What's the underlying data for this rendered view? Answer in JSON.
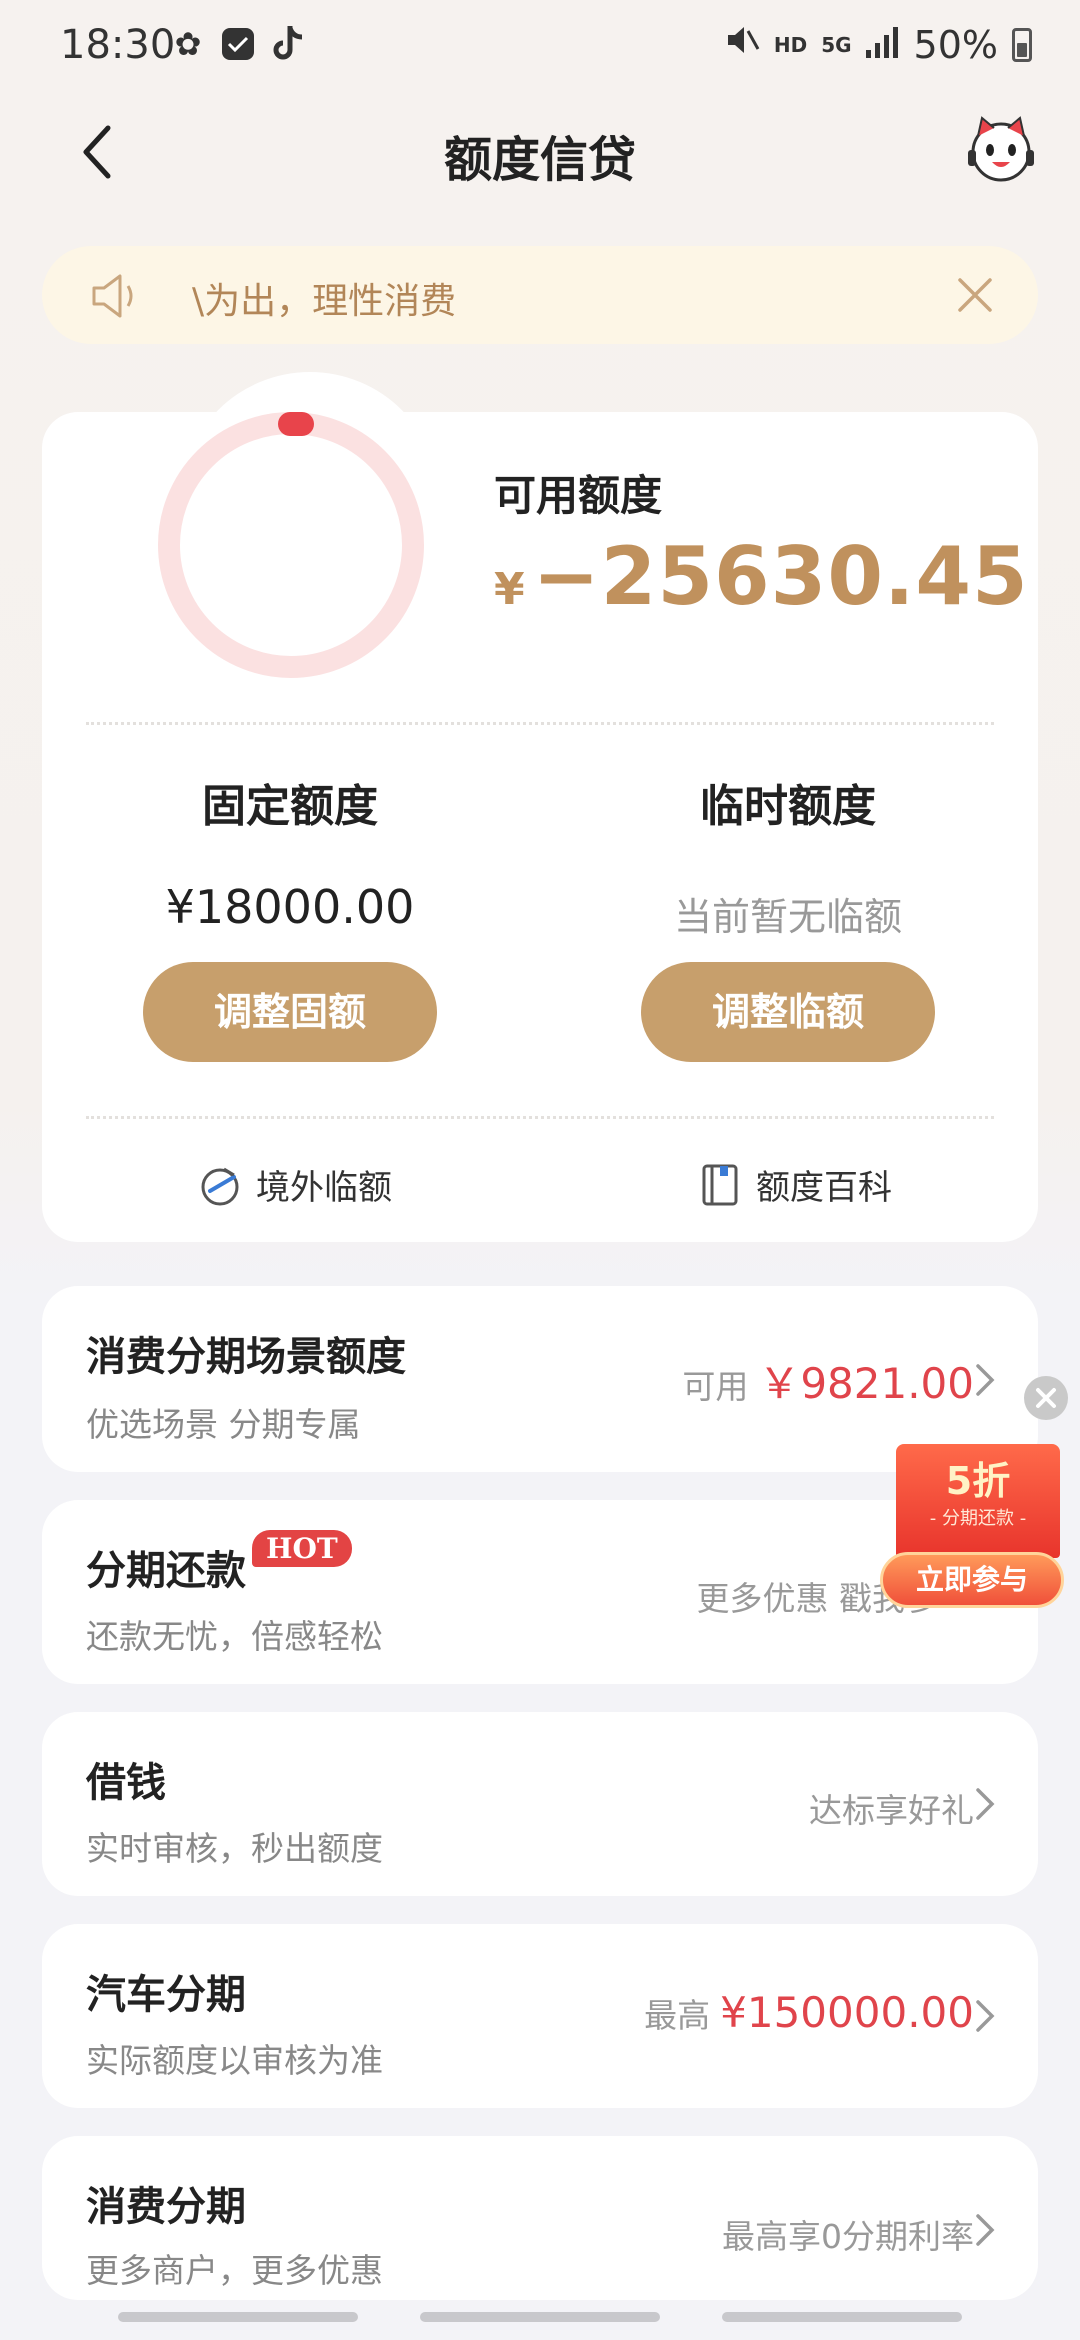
{
  "status_bar": {
    "time": "18:30",
    "hd": "HD",
    "network": "5G",
    "battery": "50%"
  },
  "nav": {
    "title": "额度信贷"
  },
  "notice": {
    "text": "\\为出，理性消费"
  },
  "credit": {
    "available_label": "可用额度",
    "currency": "¥",
    "available_amount": "−25630.45",
    "fixed_title": "固定额度",
    "fixed_value": "¥18000.00",
    "fixed_button": "调整固额",
    "temp_title": "临时额度",
    "temp_value": "当前暂无临额",
    "temp_button": "调整临额",
    "link_overseas": "境外临额",
    "link_wiki": "额度百科"
  },
  "list": [
    {
      "title": "消费分期场景额度",
      "sub": "优选场景 分期专属",
      "right_prefix": "可用",
      "right_value": "￥9821.00"
    },
    {
      "title": "分期还款",
      "badge": "HOT",
      "sub": "还款无忧，倍感轻松",
      "right_text": "更多优惠 戳我参"
    },
    {
      "title": "借钱",
      "sub": "实时审核，秒出额度",
      "right_text": "达标享好礼"
    },
    {
      "title": "汽车分期",
      "sub": "实际额度以审核为准",
      "right_prefix": "最高",
      "right_value": "¥150000.00"
    },
    {
      "title": "消费分期",
      "sub": "更多商户，更多优惠",
      "right_text": "最高享0分期利率"
    }
  ],
  "promo": {
    "big": "5折",
    "small": "- 分期还款 -",
    "button": "立即参与"
  },
  "colors": {
    "accent_gold": "#c79f6c",
    "amount_gold": "#c0915d",
    "red": "#e0444b",
    "notice_bg": "#fdf6e6"
  }
}
